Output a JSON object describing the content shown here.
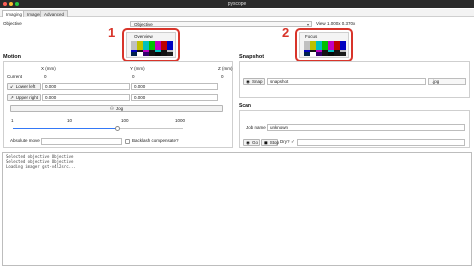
{
  "window": {
    "title": "pyscope"
  },
  "tabs": [
    {
      "label": "Imaging",
      "active": true
    },
    {
      "label": "Imager",
      "active": false
    },
    {
      "label": "Advanced",
      "active": false
    }
  ],
  "objective": {
    "label": "Objective",
    "selected": "Objective",
    "view_label": "View",
    "view_value": "1.000x 0.370x"
  },
  "previews": [
    {
      "marker": "1",
      "label": "Overview"
    },
    {
      "marker": "2",
      "label": "Focus"
    }
  ],
  "test_pattern": {
    "top": [
      "#c0c0c0",
      "#c0c000",
      "#00c0c0",
      "#00c000",
      "#c000c0",
      "#c00000",
      "#0000c0"
    ],
    "mid": [
      "#0000c0",
      "#131313",
      "#c000c0",
      "#131313",
      "#00c0c0",
      "#131313",
      "#c0c0c0"
    ],
    "bot": [
      "#00214c",
      "#ffffff",
      "#32006a",
      "#131313",
      "#090909",
      "#131313",
      "#1d1d1d"
    ]
  },
  "motion": {
    "title": "Motion",
    "col_x": "X (mm)",
    "col_y": "Y (mm)",
    "col_z": "Z (mm)",
    "current_label": "Current",
    "current_x": "0",
    "current_y": "0",
    "current_z": "0",
    "lower_left_label": "Lower left",
    "lower_left_x": "0.000",
    "lower_left_y": "0.000",
    "upper_right_label": "Upper right",
    "upper_right_x": "0.000",
    "upper_right_y": "0.000",
    "jog_label": "Jog",
    "step_ticks": [
      "1",
      "10",
      "100",
      "1000"
    ],
    "step_level": 0.62,
    "absolute_move_label": "Absolute move",
    "backlash_label": "Backlash compensate?"
  },
  "snapshot": {
    "title": "Snapshot",
    "button_label": "Snap",
    "filename": "snapshot",
    "extension": ".jpg"
  },
  "scan": {
    "title": "Scan",
    "job_label": "Job name",
    "job_value": "unknown",
    "go_label": "Go",
    "stop_label": "Stop",
    "dry_label": "Dry?",
    "dry_checked": true
  },
  "log": {
    "lines": [
      "Selected objective Objective",
      "Selected objective Objective",
      "Loading imager gst-v4l2src..."
    ]
  },
  "colors": {
    "accent": "#3478f6",
    "highlight_red": "#d8342a",
    "titlebar": "#2b2b2b"
  }
}
